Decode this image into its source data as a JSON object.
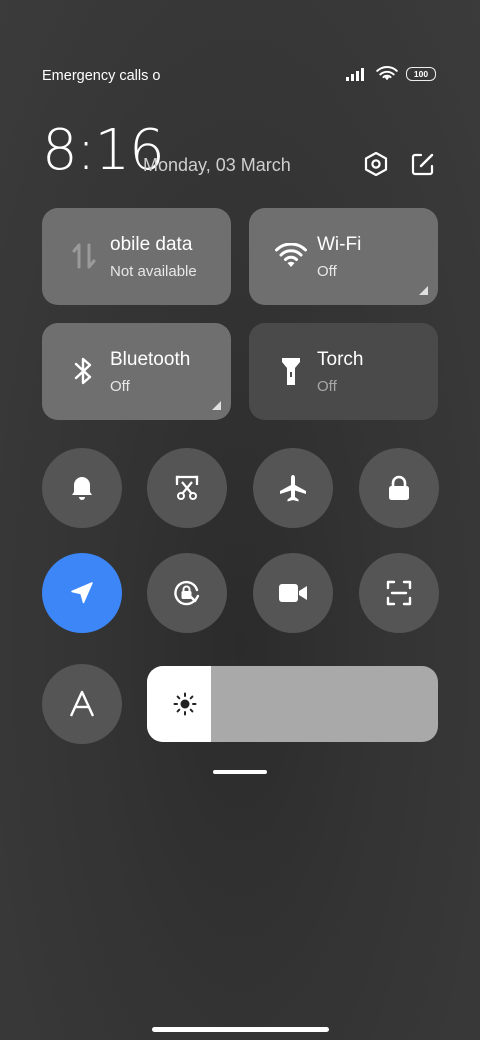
{
  "status_bar": {
    "carrier": "Emergency calls o",
    "battery": "100"
  },
  "header": {
    "time": "8:16",
    "date": "Monday, 03 March"
  },
  "tiles": [
    {
      "title": "obile data",
      "subtitle": "Not available",
      "icon": "mobile-data-icon",
      "state": "on"
    },
    {
      "title": "Wi-Fi",
      "subtitle": "Off",
      "icon": "wifi-icon",
      "state": "on"
    },
    {
      "title": "Bluetooth",
      "subtitle": "Off",
      "icon": "bluetooth-icon",
      "state": "on"
    },
    {
      "title": "Torch",
      "subtitle": "Off",
      "icon": "torch-icon",
      "state": "off"
    }
  ],
  "toggles": [
    {
      "icon": "bell-icon",
      "active": false
    },
    {
      "icon": "screenshot-scissors-icon",
      "active": false
    },
    {
      "icon": "airplane-icon",
      "active": false
    },
    {
      "icon": "lock-icon",
      "active": false
    },
    {
      "icon": "location-icon",
      "active": true
    },
    {
      "icon": "rotation-lock-icon",
      "active": false
    },
    {
      "icon": "video-camera-icon",
      "active": false
    },
    {
      "icon": "scan-icon",
      "active": false
    },
    {
      "icon": "font-a-icon",
      "active": false
    }
  ],
  "brightness": {
    "level": 0.22
  },
  "colors": {
    "accent": "#3d86f8",
    "tile_on": "#6f6f6f",
    "tile_off": "#4a4a4a",
    "circle": "#555555"
  }
}
